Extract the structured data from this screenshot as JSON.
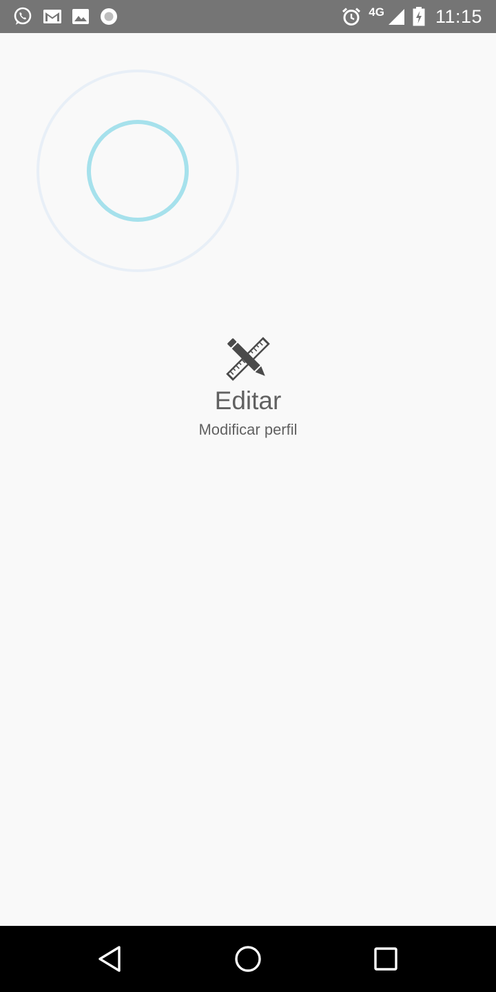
{
  "status_bar": {
    "left_icons": [
      "whatsapp-icon",
      "gmail-icon",
      "image-icon",
      "circle-app-icon"
    ],
    "right_icons": [
      "alarm-icon",
      "signal-icon",
      "battery-charging-icon"
    ],
    "network_type": "4G",
    "time": "11:15",
    "background_color": "#757575"
  },
  "main": {
    "item": {
      "icon": "ruler-pencil-icon",
      "title": "Editar",
      "subtitle": "Modificar perfil"
    },
    "accent_ring_color": "#a6e1ec",
    "outer_ring_color": "#e8eff7"
  },
  "nav_bar": {
    "buttons": [
      "back-icon",
      "home-icon",
      "recents-icon"
    ]
  }
}
